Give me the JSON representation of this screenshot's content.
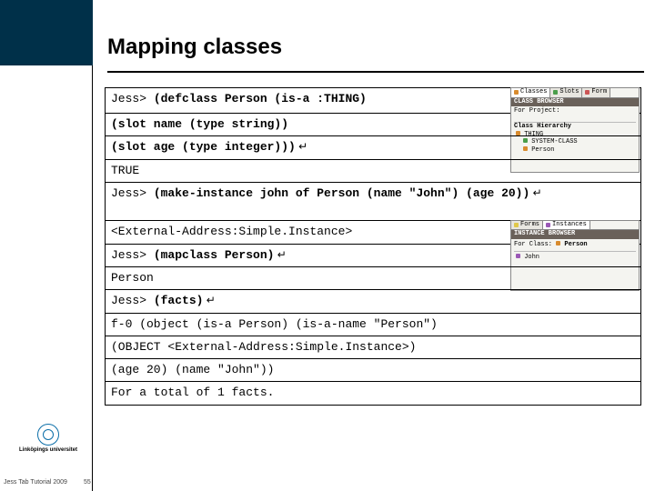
{
  "header": {
    "title": "Mapping classes"
  },
  "leftpanel": {
    "university": "Linköpings universitet",
    "sub": "",
    "footer": "Jess Tab Tutorial 2009",
    "pagenum": "55"
  },
  "code": {
    "l1a": "Jess> ",
    "l1b": "(defclass Person (is-a :THING)",
    "l2": "(slot name (type string))",
    "l3a": "(slot age (type integer)))",
    "l3ret": " ↵",
    "l4": "TRUE",
    "l5a": "Jess> ",
    "l5b": "(make-instance john of Person (name \"John\") (age 20))",
    "l5ret": " ↵",
    "l6": "<External-Address:Simple.Instance>",
    "l7a": "Jess> ",
    "l7b": "(mapclass Person)",
    "l7ret": " ↵",
    "l8": "Person",
    "l9a": "Jess> ",
    "l9b": "(facts)",
    "l9ret": " ↵",
    "l10": "f-0 (object (is-a Person) (is-a-name \"Person\")",
    "l11": "(OBJECT <External-Address:Simple.Instance>)",
    "l12": "(age 20) (name \"John\"))",
    "l13": "For a total of 1 facts."
  },
  "protege1": {
    "tab1": "Classes",
    "tab2": "Slots",
    "tab3": "Form",
    "bar": "CLASS BROWSER",
    "proj": "For Project:",
    "hier": "Class Hierarchy",
    "n1": "THING",
    "n2": "SYSTEM-CLASS",
    "n3": "Person"
  },
  "protege2": {
    "tab1": "Forms",
    "tab2": "Instances",
    "bar": "INSTANCE BROWSER",
    "cls": "For Class:",
    "clsv": "Person",
    "n1": "John"
  }
}
